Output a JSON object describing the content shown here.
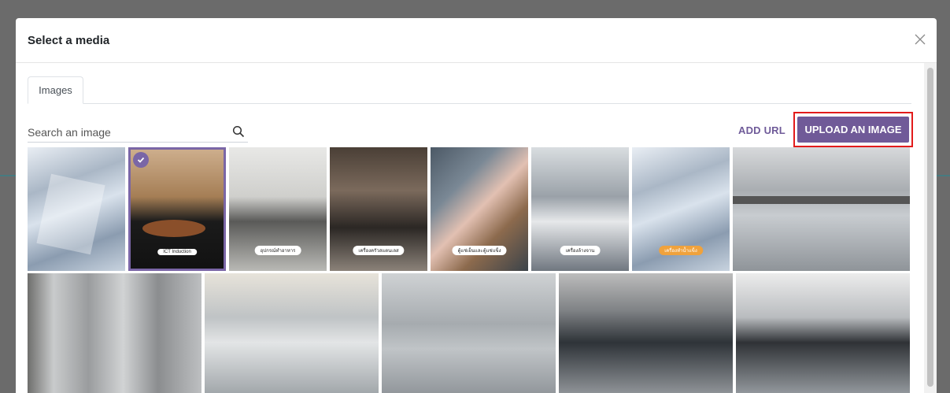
{
  "modal": {
    "title": "Select a media",
    "close_icon": "close-icon"
  },
  "tabs": [
    {
      "label": "Images",
      "active": true
    }
  ],
  "search": {
    "placeholder": "Search an image",
    "value": "",
    "icon": "search-icon"
  },
  "actions": {
    "add_url_label": "ADD URL",
    "upload_label": "UPLOAD AN IMAGE"
  },
  "colors": {
    "accent": "#705a98",
    "highlight": "#e21b1b"
  },
  "images": [
    {
      "name": "ice-cubes",
      "tag": "",
      "selected": false
    },
    {
      "name": "cooking-pan",
      "tag": "ICT Induction",
      "selected": true
    },
    {
      "name": "kitchen-wall",
      "tag": "อุปกรณ์ทำอาหาร",
      "selected": false
    },
    {
      "name": "gas-stove",
      "tag": "เครื่องครัวสแตนเลส",
      "selected": false
    },
    {
      "name": "fish-ice",
      "tag": "ตู้แช่เย็นและตู้แช่แข็ง",
      "selected": false
    },
    {
      "name": "dishwasher",
      "tag": "เครื่องล้างจาน",
      "selected": false
    },
    {
      "name": "ice-cubes-2",
      "tag": "เครื่องทำน้ำแข็ง",
      "selected": false
    },
    {
      "name": "steel-kitchen",
      "tag": "",
      "selected": false
    },
    {
      "name": "fridge",
      "tag": "",
      "selected": false
    },
    {
      "name": "counter-fridge",
      "tag": "",
      "selected": false
    },
    {
      "name": "sink-counter",
      "tag": "",
      "selected": false
    },
    {
      "name": "combi-oven",
      "tag": "",
      "selected": false
    },
    {
      "name": "coffee-station",
      "tag": "",
      "selected": false
    }
  ]
}
